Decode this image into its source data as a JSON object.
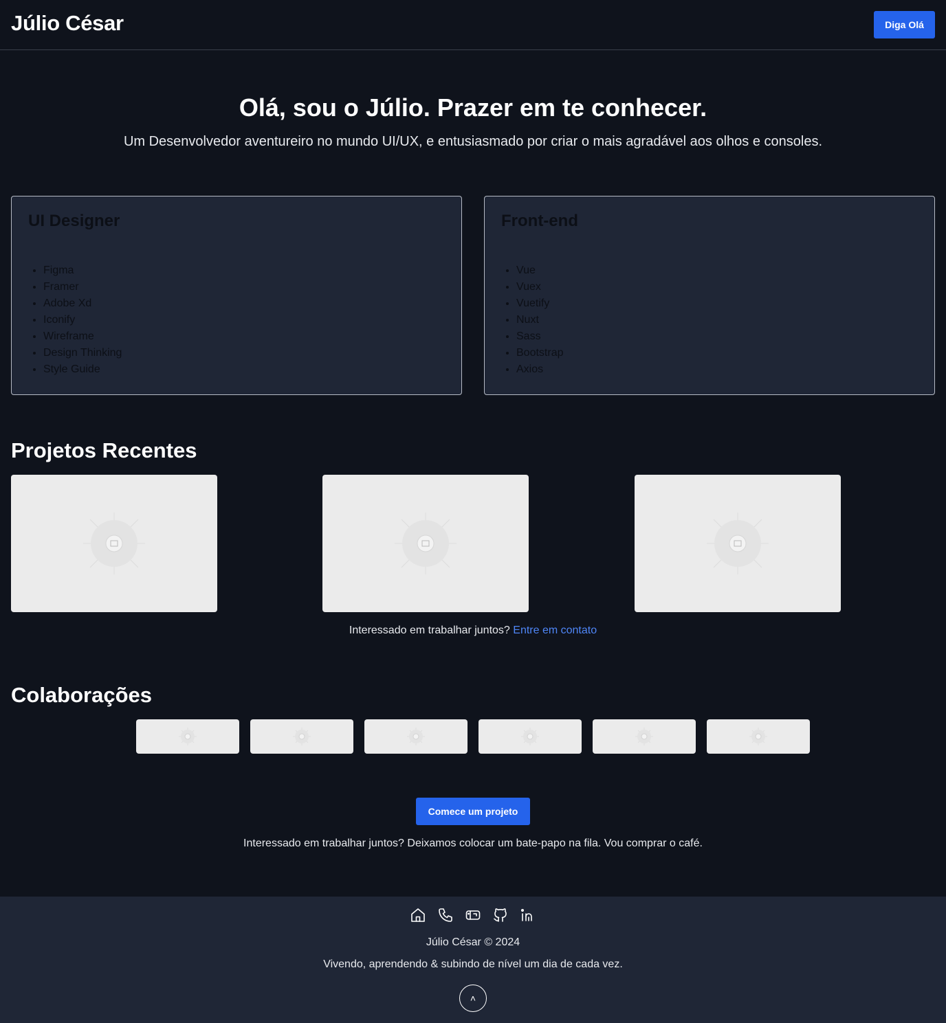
{
  "header": {
    "brand": "Júlio César",
    "cta_label": "Diga Olá"
  },
  "hero": {
    "title": "Olá, sou o Júlio. Prazer em te conhecer.",
    "subtitle": "Um Desenvolvedor aventureiro no mundo UI/UX, e entusiasmado por criar o mais agradável aos olhos e consoles."
  },
  "skills": [
    {
      "title": "UI Designer",
      "items": [
        "Figma",
        "Framer",
        "Adobe Xd",
        "Iconify",
        "Wireframe",
        "Design Thinking",
        "Style Guide"
      ]
    },
    {
      "title": "Front-end",
      "items": [
        "Vue",
        "Vuex",
        "Vuetify",
        "Nuxt",
        "Sass",
        "Bootstrap",
        "Axios"
      ]
    }
  ],
  "projects": {
    "title": "Projetos Recentes",
    "contact_text": "Interessado em trabalhar juntos?",
    "contact_link": "Entre em contato"
  },
  "collaborations": {
    "title": "Colaborações"
  },
  "cta": {
    "button_label": "Comece um projeto",
    "text": "Interessado em trabalhar juntos? Deixamos colocar um bate-papo na fila. Vou comprar o café."
  },
  "footer": {
    "icons": [
      "home-icon",
      "phone-icon",
      "mailbox-icon",
      "github-icon",
      "linkedin-icon"
    ],
    "copyright": "Júlio César © 2024",
    "motto": "Vivendo, aprendendo & subindo de nível um dia de cada vez.",
    "back_to_top": "˄"
  },
  "colors": {
    "background": "#0f131c",
    "card_background": "#1f2636",
    "accent": "#2563eb",
    "link": "#4f86f7",
    "placeholder": "#ebebeb"
  }
}
